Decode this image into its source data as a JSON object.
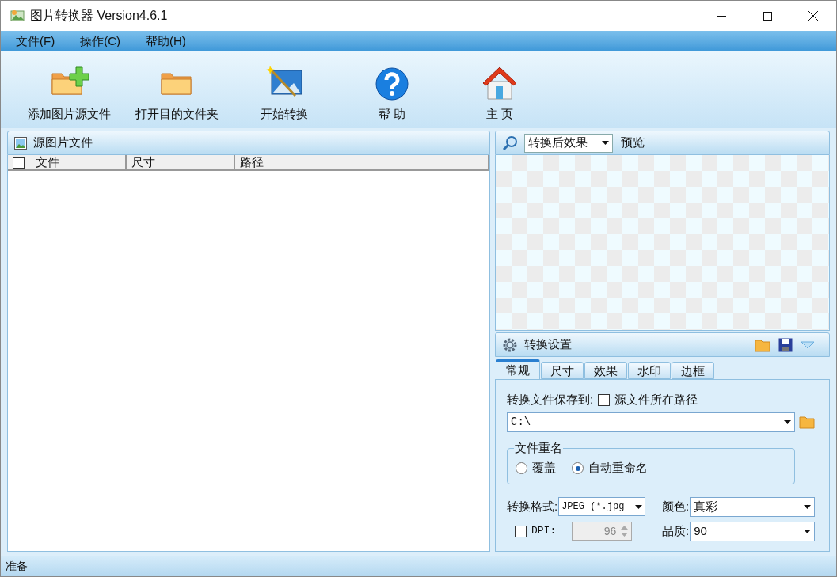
{
  "window": {
    "title": "图片转换器 Version4.6.1"
  },
  "menu": [
    {
      "label": "文件(F)"
    },
    {
      "label": "操作(C)"
    },
    {
      "label": "帮助(H)"
    }
  ],
  "toolbar": [
    {
      "kind": "add-folder",
      "label": "添加图片源文件"
    },
    {
      "kind": "folder",
      "label": "打开目的文件夹"
    },
    {
      "kind": "wand",
      "label": "开始转换"
    },
    {
      "kind": "help",
      "label": "帮 助"
    },
    {
      "kind": "home",
      "label": "主 页"
    }
  ],
  "source_panel": {
    "title": "源图片文件",
    "select_all_checked": false,
    "columns": [
      "文件",
      "尺寸",
      "路径"
    ]
  },
  "preview_panel": {
    "mode": "转换后效果",
    "label": "预览"
  },
  "settings_panel": {
    "title": "转换设置",
    "tabs": [
      {
        "label": "常规",
        "selected": true
      },
      {
        "label": "尺寸",
        "selected": false
      },
      {
        "label": "效果",
        "selected": false
      },
      {
        "label": "水印",
        "selected": false
      },
      {
        "label": "边框",
        "selected": false
      }
    ],
    "save_to_label": "转换文件保存到:",
    "source_path": {
      "label": "源文件所在路径",
      "checked": false
    },
    "path": "C:\\",
    "rename": {
      "title": "文件重名",
      "options": [
        {
          "label": "覆盖",
          "selected": false
        },
        {
          "label": "自动重命名",
          "selected": true
        }
      ]
    },
    "format": {
      "label": "转换格式:",
      "value": "JPEG (*.jpg"
    },
    "color": {
      "label": "颜色:",
      "value": "真彩"
    },
    "dpi": {
      "label": "DPI:",
      "checked": false,
      "value": "96",
      "disabled": true
    },
    "quality": {
      "label": "品质:",
      "value": "90"
    }
  },
  "status_bar": {
    "text": "准备"
  }
}
